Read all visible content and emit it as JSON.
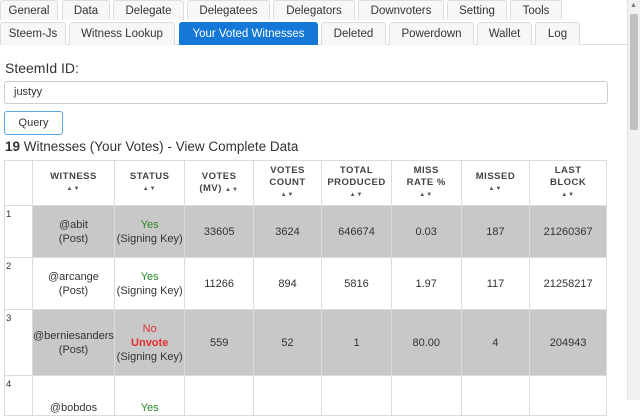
{
  "tabs_row1": [
    "General",
    "Data",
    "Delegate",
    "Delegatees",
    "Delegators",
    "Downvoters",
    "Setting",
    "Tools"
  ],
  "tabs_row2": [
    "Steem-Js",
    "Witness Lookup",
    "Your Voted Witnesses",
    "Deleted",
    "Powerdown",
    "Wallet",
    "Log"
  ],
  "active_tab": "Your Voted Witnesses",
  "form": {
    "label": "SteemId ID:",
    "value": "justyy",
    "button": "Query"
  },
  "summary": {
    "count": "19",
    "text": " Witnesses (Your Votes) - View Complete Data"
  },
  "table": {
    "headers": [
      {
        "l1": "WITNESS",
        "l2": ""
      },
      {
        "l1": "STATUS",
        "l2": ""
      },
      {
        "l1": "VOTES",
        "l2": "(MV)"
      },
      {
        "l1": "VOTES",
        "l2": "COUNT"
      },
      {
        "l1": "TOTAL",
        "l2": "PRODUCED"
      },
      {
        "l1": "MISS",
        "l2": "RATE %"
      },
      {
        "l1": "MISSED",
        "l2": ""
      },
      {
        "l1": "LAST",
        "l2": "BLOCK"
      }
    ],
    "rows": [
      {
        "idx": "1",
        "witness": "@abit",
        "post": "(Post)",
        "status": "Yes",
        "status_sub": "(Signing Key)",
        "unvote": "",
        "votes_mv": "33605",
        "votes_count": "3624",
        "total_produced": "646674",
        "miss_rate": "0.03",
        "missed": "187",
        "last_block": "21260367"
      },
      {
        "idx": "2",
        "witness": "@arcange",
        "post": "(Post)",
        "status": "Yes",
        "status_sub": "(Signing Key)",
        "unvote": "",
        "votes_mv": "11266",
        "votes_count": "894",
        "total_produced": "5816",
        "miss_rate": "1.97",
        "missed": "117",
        "last_block": "21258217"
      },
      {
        "idx": "3",
        "witness": "@berniesanders",
        "post": "(Post)",
        "status": "No",
        "status_sub": "(Signing Key)",
        "unvote": "Unvote",
        "votes_mv": "559",
        "votes_count": "52",
        "total_produced": "1",
        "miss_rate": "80.00",
        "missed": "4",
        "last_block": "204943"
      },
      {
        "idx": "4",
        "witness": "@bobdos",
        "post": "",
        "status": "Yes",
        "status_sub": "",
        "unvote": "",
        "votes_mv": "",
        "votes_count": "",
        "total_produced": "",
        "miss_rate": "",
        "missed": "",
        "last_block": ""
      }
    ]
  },
  "colors": {
    "active_tab": "#1478d8",
    "row_shade": "#c8c8c8",
    "yes": "#2a8a2a",
    "no": "#e03030"
  }
}
